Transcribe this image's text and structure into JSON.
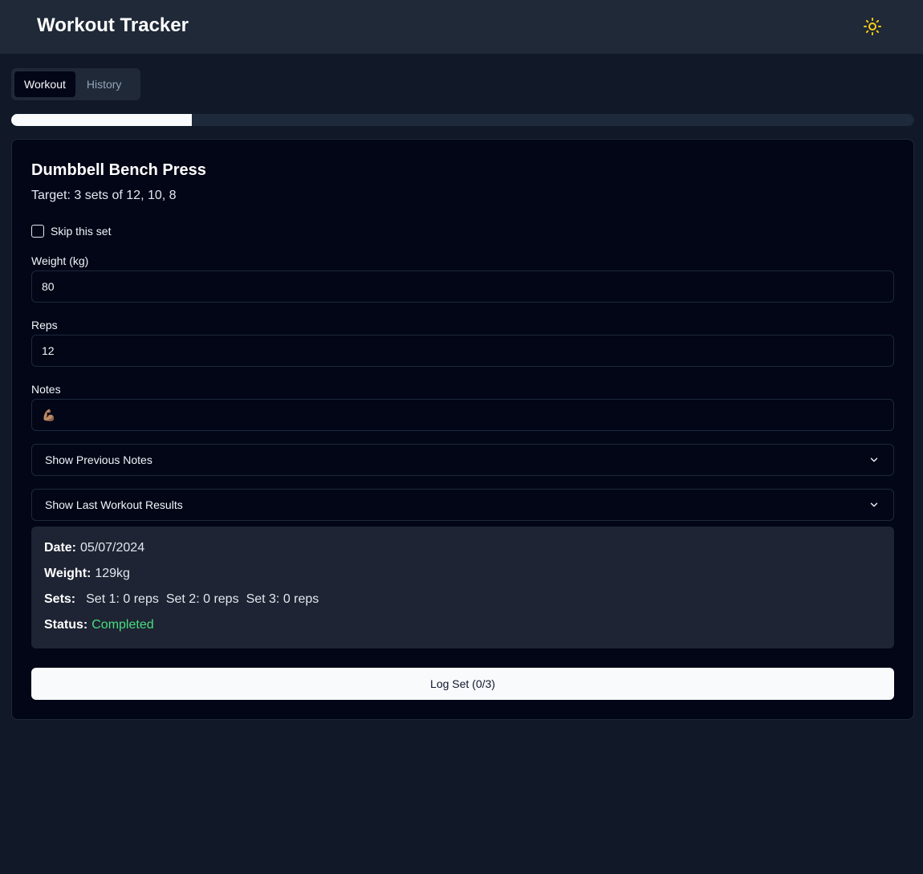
{
  "app": {
    "title": "Workout Tracker",
    "theme_icon": "sun-icon"
  },
  "tabs": [
    {
      "label": "Workout",
      "active": true
    },
    {
      "label": "History",
      "active": false
    }
  ],
  "progress": {
    "fraction": 0.2
  },
  "exercise": {
    "name": "Dumbbell Bench Press",
    "target": "Target: 3 sets of 12, 10, 8"
  },
  "skip": {
    "label": "Skip this set",
    "checked": false
  },
  "fields": {
    "weight": {
      "label": "Weight (kg)",
      "value": "80"
    },
    "reps": {
      "label": "Reps",
      "value": "12"
    },
    "notes": {
      "label": "Notes",
      "value": "💪🏽"
    }
  },
  "collapsibles": {
    "previous_notes": "Show Previous Notes",
    "last_workout": "Show Last Workout Results"
  },
  "last_workout": {
    "date_label": "Date:",
    "date": "05/07/2024",
    "weight_label": "Weight:",
    "weight": "129kg",
    "sets_label": "Sets:",
    "sets": [
      "Set 1: 0 reps",
      "Set 2: 0 reps",
      "Set 3: 0 reps"
    ],
    "status_label": "Status:",
    "status": "Completed",
    "status_color": "#4ade80"
  },
  "log_button": "Log Set (0/3)"
}
